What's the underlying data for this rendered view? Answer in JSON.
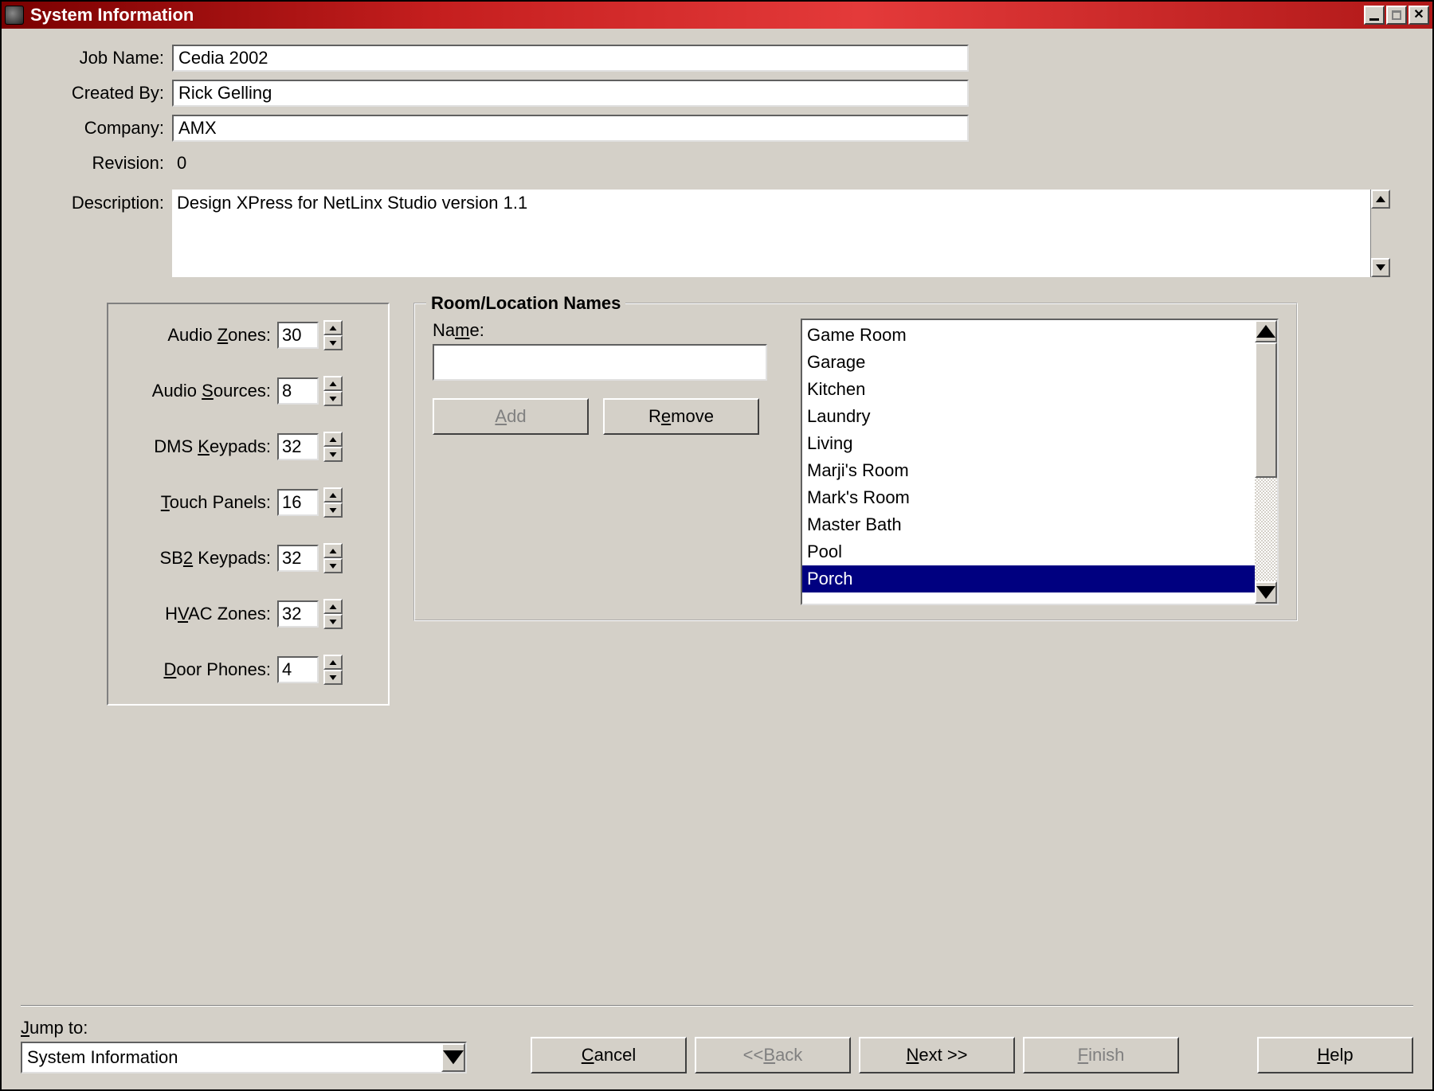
{
  "title": "System Information",
  "fields": {
    "job_name_label": "Job Name:",
    "job_name_value": "Cedia 2002",
    "created_by_label": "Created By:",
    "created_by_value": "Rick Gelling",
    "company_label": "Company:",
    "company_value": "AMX",
    "revision_label": "Revision:",
    "revision_value": "0",
    "description_label": "Description:",
    "description_value": "Design XPress for NetLinx Studio version 1.1"
  },
  "spinners": {
    "audio_zones_label_pre": "Audio ",
    "audio_zones_label_u": "Z",
    "audio_zones_label_post": "ones:",
    "audio_zones_value": "30",
    "audio_sources_label_pre": "Audio ",
    "audio_sources_label_u": "S",
    "audio_sources_label_post": "ources:",
    "audio_sources_value": "8",
    "dms_keypads_label_pre": "DMS ",
    "dms_keypads_label_u": "K",
    "dms_keypads_label_post": "eypads:",
    "dms_keypads_value": "32",
    "touch_panels_label_pre": "",
    "touch_panels_label_u": "T",
    "touch_panels_label_post": "ouch Panels:",
    "touch_panels_value": "16",
    "sb2_keypads_label_pre": "SB",
    "sb2_keypads_label_u": "2",
    "sb2_keypads_label_post": " Keypads:",
    "sb2_keypads_value": "32",
    "hvac_zones_label_pre": "H",
    "hvac_zones_label_u": "V",
    "hvac_zones_label_post": "AC Zones:",
    "hvac_zones_value": "32",
    "door_phones_label_pre": "",
    "door_phones_label_u": "D",
    "door_phones_label_post": "oor Phones:",
    "door_phones_value": "4"
  },
  "room_group": {
    "title": "Room/Location Names",
    "name_label_pre": "Na",
    "name_label_u": "m",
    "name_label_post": "e:",
    "name_value": "",
    "add_btn_u": "A",
    "add_btn_post": "dd",
    "remove_btn_pre": "R",
    "remove_btn_u": "e",
    "remove_btn_post": "move",
    "rooms": [
      "Game Room",
      "Garage",
      "Kitchen",
      "Laundry",
      "Living",
      "Marji's Room",
      "Mark's Room",
      "Master Bath",
      "Pool",
      "Porch"
    ],
    "selected_index": 9
  },
  "footer": {
    "jump_label_u": "J",
    "jump_label_post": "ump to:",
    "jump_value": "System Information",
    "cancel_u": "C",
    "cancel_post": "ancel",
    "back_pre": "<< ",
    "back_u": "B",
    "back_post": "ack",
    "next_u": "N",
    "next_post": "ext >>",
    "finish_u": "F",
    "finish_post": "inish",
    "help_u": "H",
    "help_post": "elp"
  }
}
